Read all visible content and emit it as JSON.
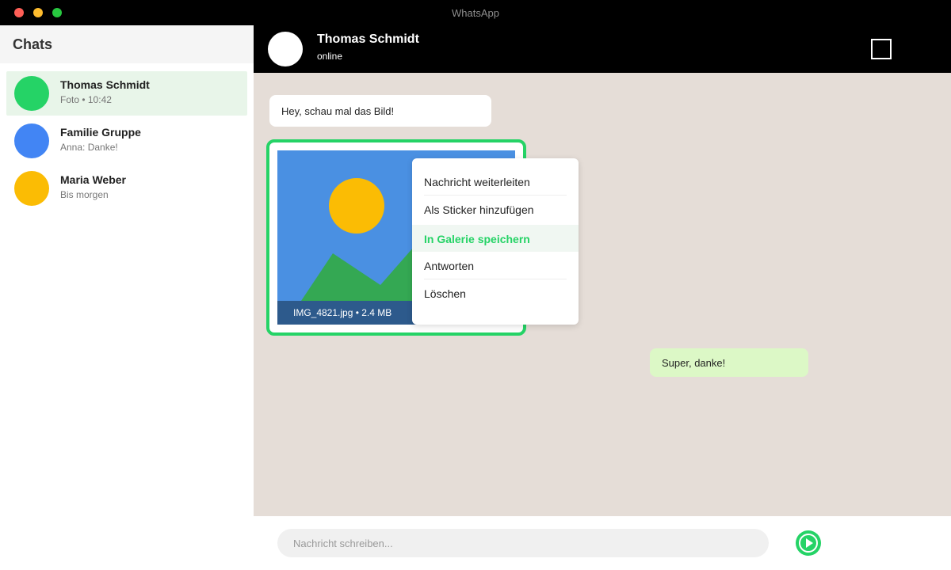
{
  "window": {
    "title": "WhatsApp"
  },
  "sidebar": {
    "title": "Chats",
    "chats": [
      {
        "name": "Thomas Schmidt",
        "preview": "Foto • 10:42",
        "avatar_color": "#25d366",
        "active": true
      },
      {
        "name": "Familie Gruppe",
        "preview": "Anna: Danke!",
        "avatar_color": "#4285f4",
        "active": false
      },
      {
        "name": "Maria Weber",
        "preview": "Bis morgen",
        "avatar_color": "#fbbc04",
        "active": false
      }
    ]
  },
  "header": {
    "name": "Thomas Schmidt",
    "status": "online"
  },
  "messages": {
    "incoming_text": "Hey, schau mal das Bild!",
    "image_caption": "IMG_4821.jpg • 2.4 MB",
    "outgoing_text": "Super, danke!"
  },
  "context_menu": {
    "items": [
      "Nachricht weiterleiten",
      "Als Sticker hinzufügen",
      "In Galerie speichern",
      "Antworten",
      "Löschen"
    ],
    "highlighted": "In Galerie speichern"
  },
  "composer": {
    "placeholder": "Nachricht schreiben..."
  },
  "colors": {
    "accent": "#25d366",
    "chat_background": "#e5ddd7",
    "outgoing_bubble": "#dcf8c6",
    "image_sky": "#4a90e2",
    "image_sun": "#fbbc04",
    "image_mountain": "#34a853"
  },
  "icons": {
    "send": "play-arrow-icon",
    "header_action": "square-icon"
  }
}
